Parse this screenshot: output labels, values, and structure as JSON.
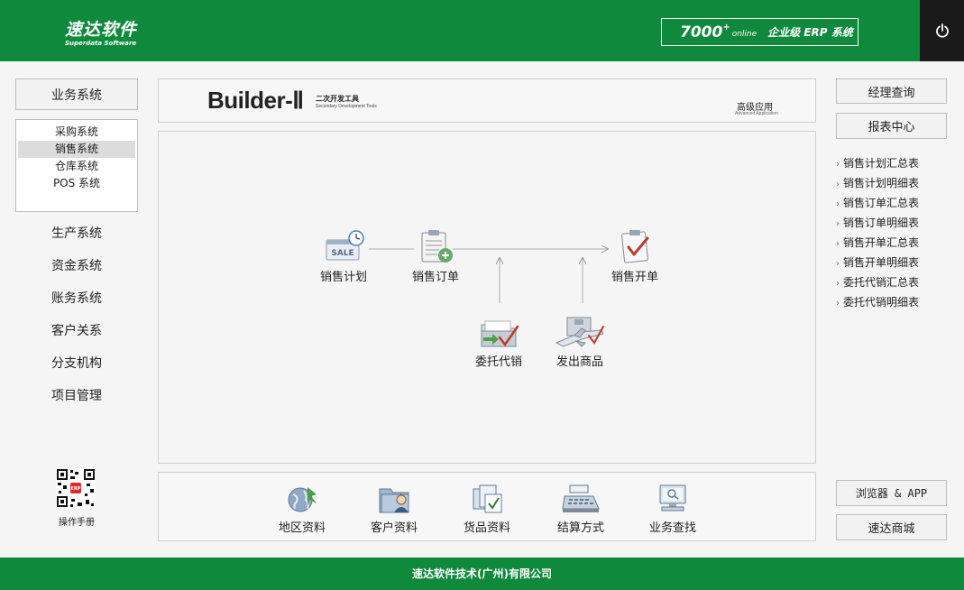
{
  "header": {
    "logo_cn": "速达软件",
    "logo_en": "Superdata Software",
    "product_num": "7000",
    "product_plus": "+",
    "product_online": "online",
    "product_name": "企业级 ERP 系统",
    "power_icon": "power-icon"
  },
  "sidebar": {
    "business_button": "业务系统",
    "subsystems": [
      {
        "label": "采购系统",
        "active": false
      },
      {
        "label": "销售系统",
        "active": true
      },
      {
        "label": "仓库系统",
        "active": false
      },
      {
        "label": "POS 系统",
        "active": false
      }
    ],
    "systems": [
      "生产系统",
      "资金系统",
      "账务系统",
      "客户关系",
      "分支机构",
      "项目管理"
    ],
    "manual_label": "操作手册"
  },
  "banner": {
    "title": "Builder-Ⅱ",
    "subtitle_cn": "二次开发工具",
    "subtitle_en": "Secondary Development Tools",
    "advanced_cn": "高级应用",
    "advanced_en": "Advanced Application"
  },
  "flow": {
    "sales_plan": "销售计划",
    "sales_order": "销售订单",
    "sales_invoice": "销售开单",
    "consignment": "委托代销",
    "ship_goods": "发出商品",
    "sale_badge": "SALE"
  },
  "tools": [
    "地区资料",
    "客户资料",
    "货品资料",
    "结算方式",
    "业务查找"
  ],
  "right": {
    "manager_query": "经理查询",
    "report_center": "报表中心",
    "reports": [
      "销售计划汇总表",
      "销售计划明细表",
      "销售订单汇总表",
      "销售订单明细表",
      "销售开单汇总表",
      "销售开单明细表",
      "委托代销汇总表",
      "委托代销明细表"
    ],
    "browser_app": "浏览器 & APP",
    "mall": "速达商城"
  },
  "footer": {
    "company": "速达软件技术(广州)有限公司"
  },
  "colors": {
    "brand_green": "#0f8a3c",
    "power_bg": "#1a1a1a"
  }
}
